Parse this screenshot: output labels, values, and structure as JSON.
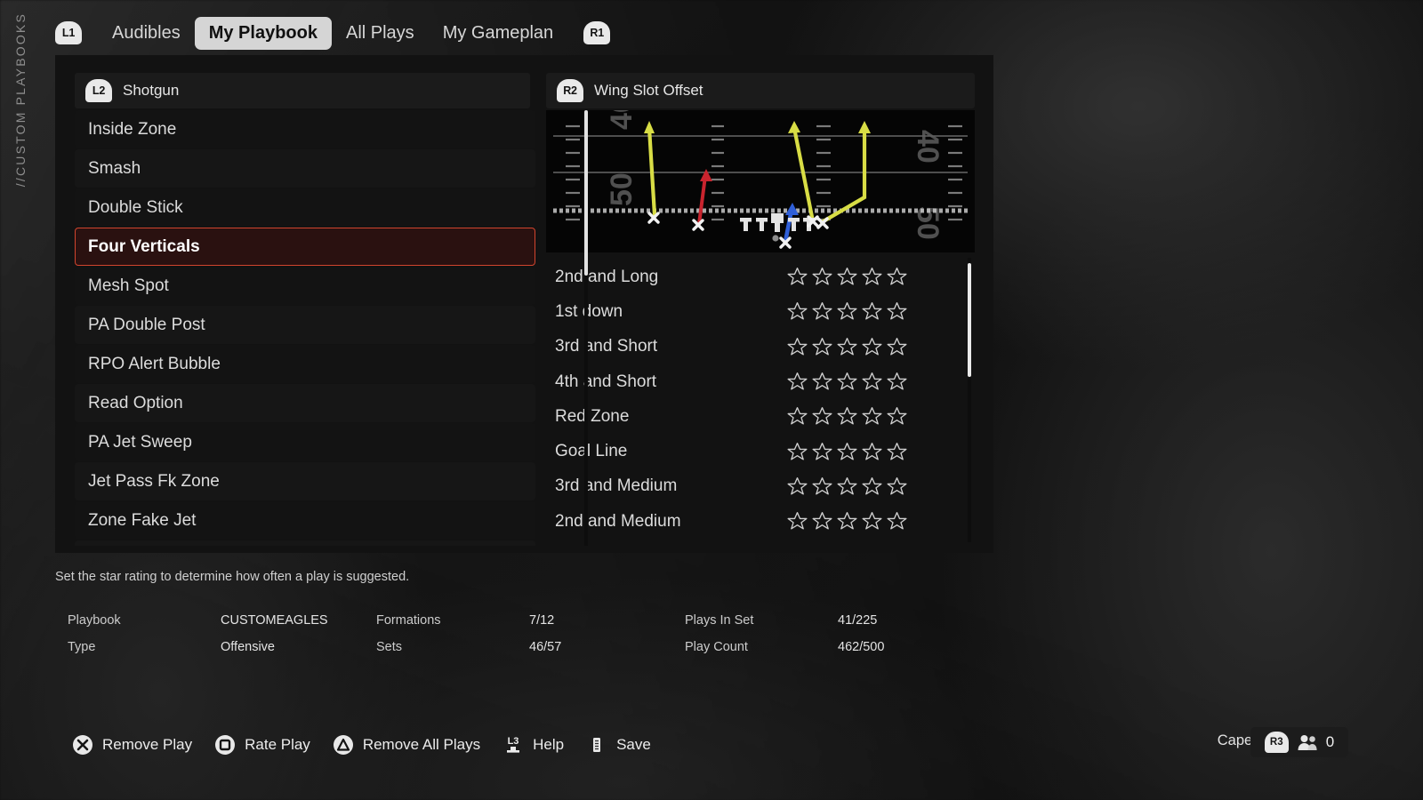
{
  "sidebar": {
    "vertical_label": "//CUSTOM PLAYBOOKS"
  },
  "topbar": {
    "left_bumper": "L1",
    "right_bumper": "R1",
    "tabs": [
      {
        "label": "Audibles",
        "active": false
      },
      {
        "label": "My Playbook",
        "active": true
      },
      {
        "label": "All Plays",
        "active": false
      },
      {
        "label": "My Gameplan",
        "active": false
      }
    ]
  },
  "formation_column": {
    "trigger": "L2",
    "title": "Shotgun",
    "plays": [
      {
        "name": "Inside Zone",
        "selected": false
      },
      {
        "name": "Smash",
        "selected": false
      },
      {
        "name": "Double Stick",
        "selected": false
      },
      {
        "name": "Four Verticals",
        "selected": true
      },
      {
        "name": "Mesh Spot",
        "selected": false
      },
      {
        "name": "PA Double Post",
        "selected": false
      },
      {
        "name": "RPO Alert Bubble",
        "selected": false
      },
      {
        "name": "Read Option",
        "selected": false
      },
      {
        "name": "PA Jet Sweep",
        "selected": false
      },
      {
        "name": "Jet Pass Fk Zone",
        "selected": false
      },
      {
        "name": "Zone Fake Jet",
        "selected": false
      },
      {
        "name": "",
        "selected": false
      }
    ]
  },
  "set_column": {
    "trigger": "R2",
    "title": "Wing Slot Offset",
    "situations": [
      {
        "label": "2nd and Long",
        "rating": 0,
        "max": 5
      },
      {
        "label": "1st down",
        "rating": 0,
        "max": 5
      },
      {
        "label": "3rd and Short",
        "rating": 0,
        "max": 5
      },
      {
        "label": "4th and Short",
        "rating": 0,
        "max": 5
      },
      {
        "label": "Red Zone",
        "rating": 0,
        "max": 5
      },
      {
        "label": "Goal Line",
        "rating": 0,
        "max": 5
      },
      {
        "label": "3rd and Medium",
        "rating": 0,
        "max": 5
      },
      {
        "label": "2nd and Medium",
        "rating": 0,
        "max": 5
      }
    ],
    "field": {
      "yard_numbers": [
        "40",
        "50",
        "40",
        "50"
      ],
      "route_colors": {
        "receiver": "#d8dd45",
        "halfback": "#2f5fd8",
        "slot": "#c9242e"
      }
    }
  },
  "hint": {
    "text": "Set the star rating to determine how often a play is suggested."
  },
  "stats": [
    {
      "key": "Playbook",
      "value": "CUSTOMEAGLES"
    },
    {
      "key": "Formations",
      "value": "7/12"
    },
    {
      "key": "Plays In Set",
      "value": "41/225"
    },
    {
      "key": "Type",
      "value": "Offensive"
    },
    {
      "key": "Sets",
      "value": "46/57"
    },
    {
      "key": "Play Count",
      "value": "462/500"
    }
  ],
  "actions": [
    {
      "glyph": "cross-button-icon",
      "label": "Remove Play"
    },
    {
      "glyph": "square-button-icon",
      "label": "Rate Play"
    },
    {
      "glyph": "triangle-button-icon",
      "label": "Remove All Plays"
    },
    {
      "glyph": "l3-button-icon",
      "label": "Help"
    },
    {
      "glyph": "options-button-icon",
      "label": "Save"
    }
  ],
  "user": {
    "name": "CapeGaming",
    "touchpad_icon": "touchpad-icon",
    "friends_trigger": "R3",
    "friends_icon": "friends-icon",
    "friends_count": "0"
  }
}
